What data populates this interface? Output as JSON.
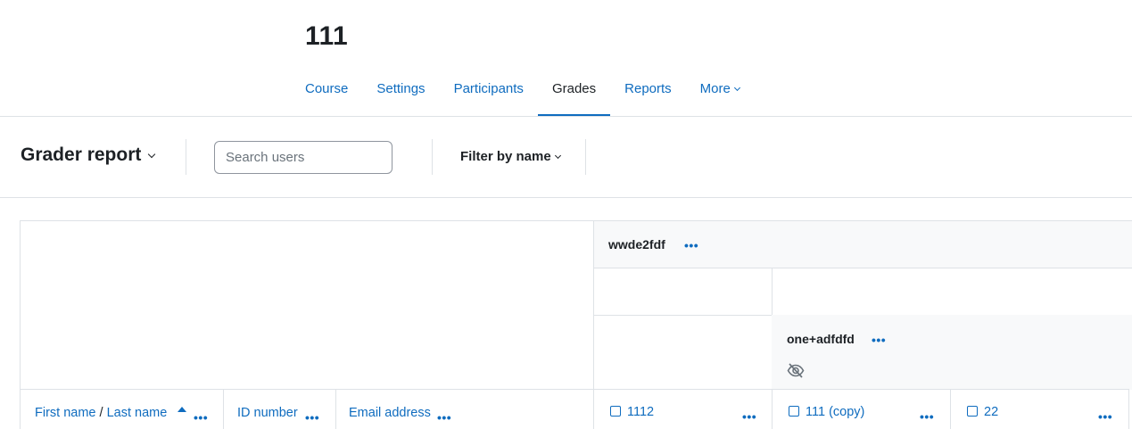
{
  "course": {
    "title": "111"
  },
  "nav": {
    "items": [
      {
        "label": "Course"
      },
      {
        "label": "Settings"
      },
      {
        "label": "Participants"
      },
      {
        "label": "Grades"
      },
      {
        "label": "Reports"
      },
      {
        "label": "More"
      }
    ],
    "active": "Grades"
  },
  "toolbar": {
    "report_title": "Grader report",
    "search_placeholder": "Search users",
    "filter_label": "Filter by name"
  },
  "grid": {
    "category_top": {
      "name": "wwde2fdf",
      "menu": "•••"
    },
    "category_sub": {
      "name": "one+adfdfd",
      "menu": "•••",
      "hidden_icon": "eye-slash-icon"
    },
    "user_columns": {
      "first_name": "First name",
      "separator": "/",
      "last_name": "Last name",
      "id_number": "ID number",
      "email": "Email address",
      "menu": "•••"
    },
    "grade_items": [
      {
        "name": "1112",
        "menu": "•••"
      },
      {
        "name": "111 (copy)",
        "menu": "•••"
      },
      {
        "name": "22",
        "menu": "•••"
      }
    ]
  },
  "colors": {
    "link": "#0f6cbf",
    "text": "#1d2125",
    "border": "#dee2e6",
    "header_bg": "#f8f9fa"
  }
}
